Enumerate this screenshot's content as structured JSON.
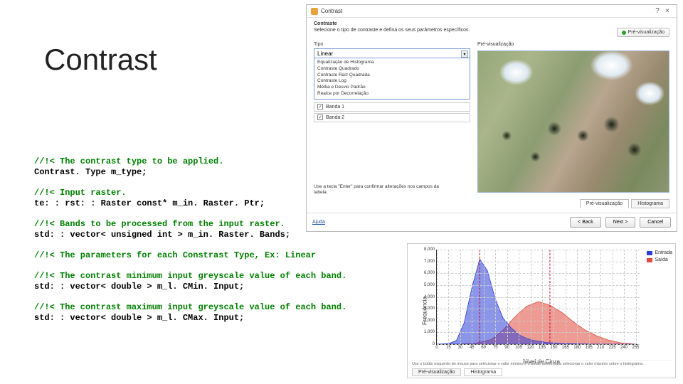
{
  "title": "Contrast",
  "code": {
    "c1": "//!< The contrast type to be applied.",
    "l1": "Contrast. Type m_type;",
    "c2": "//!< Input raster.",
    "l2": "te: : rst: : Raster const* m_in. Raster. Ptr;",
    "c3": "//!< Bands to be processed from the input raster.",
    "l3": "std: : vector< unsigned int > m_in. Raster. Bands;",
    "c4": "//!< The parameters for each Constrast Type, Ex: Linear",
    "c5": "//!< The contrast minimum input greyscale value of each band.",
    "l5": "std: : vector< double > m_l. CMin. Input;",
    "c6": "//!< The contrast maximum input greyscale value of each band.",
    "l6": "std: : vector< double > m_l. CMax. Input;"
  },
  "dialog": {
    "title": "Contrast",
    "help_icon": "?",
    "close_icon": "×",
    "head1": "Contraste",
    "head2": "Selecione o tipo de contraste e defina os seus parâmetros específicos.",
    "type_label": "Tipo",
    "type_value": "Linear",
    "type_options": [
      "Equalização de Histograma",
      "Contraste Quadrado",
      "Contraste Raiz Quadrada",
      "Contraste Log",
      "Média e Desvio Padrão",
      "Realce por Decorrelação"
    ],
    "band1": "Banda 1",
    "band2": "Banda 2",
    "hint1": "Use a tecla \"Enter\" para confirmar alterações nos campos da",
    "hint2": "tabela.",
    "preview_group": "Pré-visualização",
    "preview_btn": "Pré-visualização",
    "tab1": "Pré-visualização",
    "tab2": "Histograma",
    "help_link": "Ajuda",
    "back": "< Back",
    "next": "Next >",
    "cancel": "Cancel"
  },
  "chart_data": {
    "type": "area",
    "title": "",
    "xlabel": "Nível de Cinza",
    "ylabel": "Frequência",
    "xlim": [
      0,
      260
    ],
    "ylim": [
      0,
      8000
    ],
    "xticks": [
      0,
      15,
      30,
      45,
      60,
      75,
      90,
      105,
      120,
      135,
      150,
      165,
      180,
      195,
      210,
      225,
      240,
      255
    ],
    "yticks": [
      0,
      1000,
      2000,
      3000,
      4000,
      5000,
      6000,
      7000,
      8000
    ],
    "series": [
      {
        "name": "Entrada",
        "color": "#2b3fd6",
        "x": [
          0,
          15,
          25,
          35,
          45,
          55,
          65,
          75,
          85,
          95,
          105,
          115,
          125,
          140,
          160,
          200,
          255
        ],
        "values": [
          0,
          50,
          300,
          1800,
          4800,
          7200,
          6200,
          3800,
          2200,
          1400,
          800,
          500,
          300,
          150,
          60,
          10,
          0
        ]
      },
      {
        "name": "Saída",
        "color": "#e0493b",
        "x": [
          0,
          30,
          50,
          70,
          85,
          100,
          115,
          130,
          145,
          160,
          175,
          190,
          205,
          220,
          235,
          255
        ],
        "values": [
          0,
          20,
          80,
          400,
          1200,
          2300,
          3200,
          3600,
          3300,
          2700,
          1900,
          1200,
          700,
          350,
          120,
          0
        ]
      }
    ],
    "vlines": [
      55,
      145
    ],
    "note": "Use o botão esquerdo do mouse para selecionar o valor mínimo e o botão direito para selecionar o valor máximo sobre o histograma.",
    "tabs": [
      "Pré-visualização",
      "Histograma"
    ],
    "active_tab": 1
  }
}
